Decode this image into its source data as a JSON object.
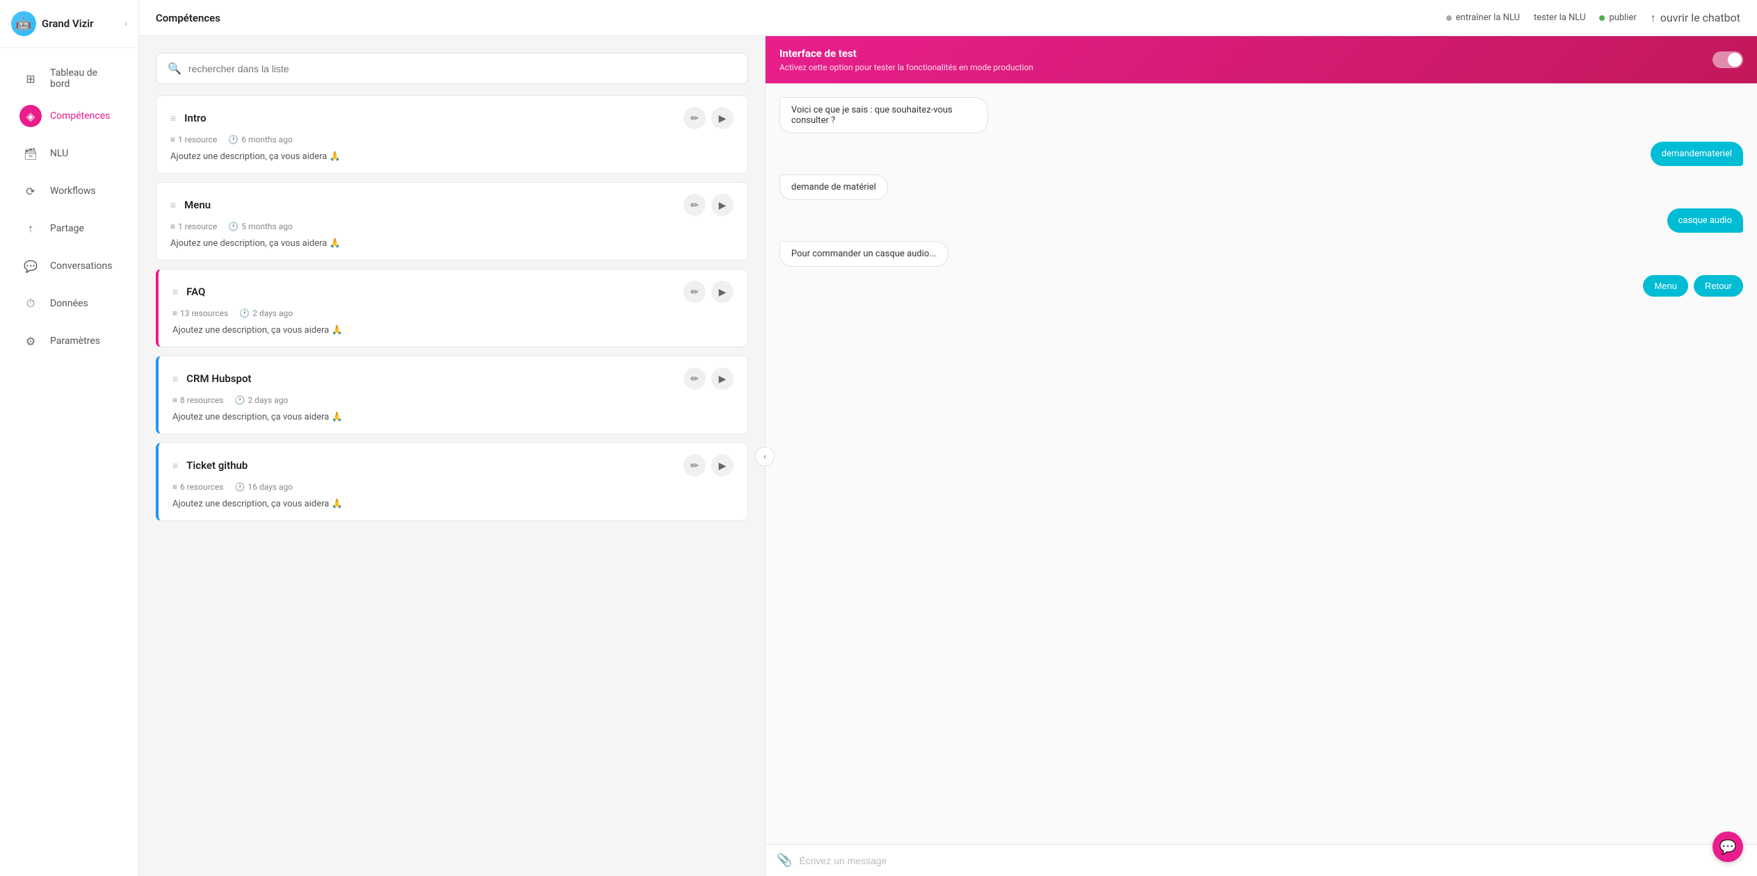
{
  "app": {
    "name": "Grand Vizir",
    "chevron": "›"
  },
  "topbar": {
    "title": "Compétences",
    "nlu_train": "entraîner la NLU",
    "nlu_test": "tester la NLU",
    "publish": "publier",
    "open_chatbot": "ouvrir le chatbot"
  },
  "sidebar": {
    "items": [
      {
        "id": "tableau-de-bord",
        "label": "Tableau de bord",
        "icon": "⊞"
      },
      {
        "id": "competences",
        "label": "Compétences",
        "icon": "◈",
        "active": true
      },
      {
        "id": "nlu",
        "label": "NLU",
        "icon": "🗃"
      },
      {
        "id": "workflows",
        "label": "Workflows",
        "icon": "⟳"
      },
      {
        "id": "partage",
        "label": "Partage",
        "icon": "↑"
      },
      {
        "id": "conversations",
        "label": "Conversations",
        "icon": "💬"
      },
      {
        "id": "donnees",
        "label": "Données",
        "icon": "⏱"
      },
      {
        "id": "parametres",
        "label": "Paramètres",
        "icon": "⚙"
      }
    ]
  },
  "search": {
    "placeholder": "rechercher dans la liste"
  },
  "skills": [
    {
      "id": "intro",
      "name": "Intro",
      "resources": "1 resource",
      "time": "6 months ago",
      "description": "Ajoutez une description, ça vous aidera 🙏",
      "accent": null
    },
    {
      "id": "menu",
      "name": "Menu",
      "resources": "1 resource",
      "time": "5 months ago",
      "description": "Ajoutez une description, ça vous aidera 🙏",
      "accent": null
    },
    {
      "id": "faq",
      "name": "FAQ",
      "resources": "13 resources",
      "time": "2 days ago",
      "description": "Ajoutez une description, ça vous aidera 🙏",
      "accent": "pink"
    },
    {
      "id": "crm-hubspot",
      "name": "CRM Hubspot",
      "resources": "8 resources",
      "time": "2 days ago",
      "description": "Ajoutez une description, ça vous aidera 🙏",
      "accent": "blue"
    },
    {
      "id": "ticket-github",
      "name": "Ticket github",
      "resources": "6 resources",
      "time": "16 days ago",
      "description": "Ajoutez une description, ça vous aidera 🙏",
      "accent": "blue"
    }
  ],
  "chat": {
    "banner_title": "Interface de test",
    "banner_desc": "Activez cette option pour tester la fonctionalités en mode production",
    "messages": [
      {
        "type": "bot",
        "text": "Voici ce que je sais : que souhaitez-vous consulter ?"
      },
      {
        "type": "user-btn",
        "text": "demandemateriel"
      },
      {
        "type": "bot",
        "text": "demande de matériel"
      },
      {
        "type": "user-btn",
        "text": "casque audio"
      },
      {
        "type": "bot",
        "text": "Pour commander un casque audio..."
      },
      {
        "type": "user-btns",
        "buttons": [
          "Menu",
          "Retour"
        ]
      }
    ],
    "input_placeholder": "Écrivez un message"
  }
}
